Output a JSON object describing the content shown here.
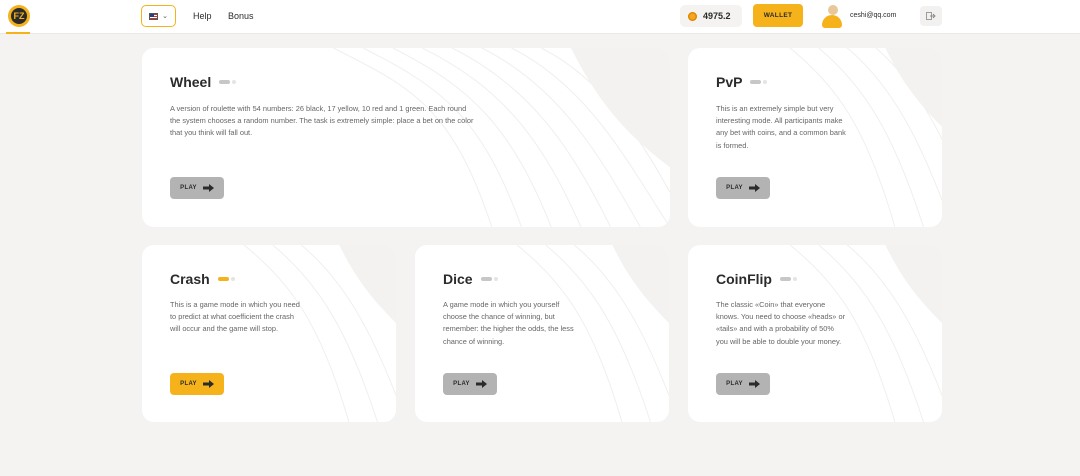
{
  "header": {
    "logo_text": "FZ",
    "language": "en",
    "nav": {
      "help": "Help",
      "bonus": "Bonus"
    },
    "balance": "4975.2",
    "wallet_label": "WALLET",
    "user_email": "ceshi@qq.com"
  },
  "colors": {
    "accent": "#f5b21b",
    "background": "#f4f3f2",
    "button_inactive": "#b3b3b3"
  },
  "games": [
    {
      "title": "Wheel",
      "description": "A version of roulette with 54 numbers: 26 black, 17 yellow, 10 red and 1 green. Each round the system chooses a random number. The task is extremely simple: place a bet on the color that you think will fall out.",
      "play_label": "PLAY",
      "active": false
    },
    {
      "title": "PvP",
      "description": "This is an extremely simple but very interesting mode. All participants make any bet with coins, and a common bank is formed.",
      "play_label": "PLAY",
      "active": false
    },
    {
      "title": "Crash",
      "description": "This is a game mode in which you need to predict at what coefficient the crash will occur and the game will stop.",
      "play_label": "PLAY",
      "active": true
    },
    {
      "title": "Dice",
      "description": "A game mode in which you yourself choose the chance of winning, but remember: the higher the odds, the less chance of winning.",
      "play_label": "PLAY",
      "active": false
    },
    {
      "title": "CoinFlip",
      "description": "The classic «Coin» that everyone knows. You need to choose «heads» or «tails» and with a probability of 50% you will be able to double your money.",
      "play_label": "PLAY",
      "active": false
    }
  ]
}
